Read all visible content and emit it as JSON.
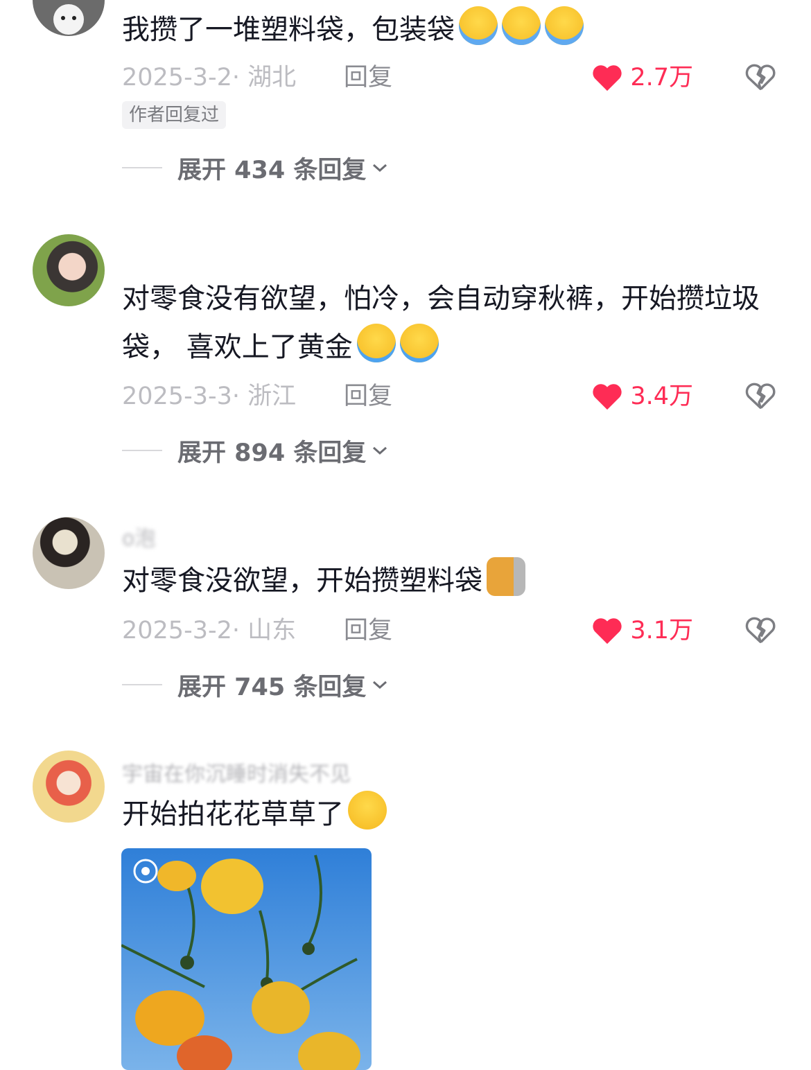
{
  "comments": [
    {
      "username": "",
      "text": "我攒了一堆塑料袋，包装袋",
      "emoji": [
        "loudly-crying-emoji",
        "loudly-crying-emoji",
        "loudly-crying-emoji"
      ],
      "date_location": "2025-3-2· 湖北",
      "reply_label": "回复",
      "likes": "2.7万",
      "tag": "作者回复过",
      "expand_label": "展开 434 条回复"
    },
    {
      "username": "",
      "text": "对零食没有欲望，怕冷，会自动穿秋裤，开始攒垃圾袋， 喜欢上了黄金",
      "emoji": [
        "tearful-laugh-emoji",
        "tearful-laugh-emoji"
      ],
      "date_location": "2025-3-3· 浙江",
      "reply_label": "回复",
      "likes": "3.4万",
      "expand_label": "展开 894 条回复"
    },
    {
      "username": "o泡",
      "text": "对零食没欲望，开始攒塑料袋",
      "emoji": [
        "peeking-cat-emoji"
      ],
      "date_location": "2025-3-2· 山东",
      "reply_label": "回复",
      "likes": "3.1万",
      "expand_label": "展开 745 条回复"
    },
    {
      "username": "宇宙在你沉睡时消失不见",
      "text": "开始拍花花草草了",
      "emoji": [
        "grinning-emoji"
      ],
      "image": "yellow-poppies-blue-sky-photo"
    }
  ],
  "colors": {
    "like": "#fe2c55",
    "meta": "#bcbcc1",
    "text": "#161823"
  }
}
